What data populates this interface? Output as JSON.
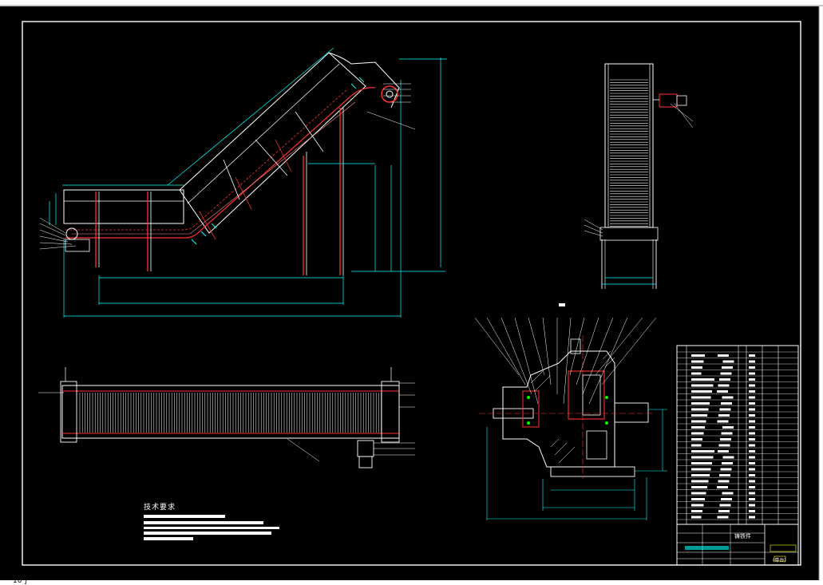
{
  "drawing": {
    "tech_requirements_heading": "技术要求",
    "title_block_label": "铸铁件",
    "title_block_sub": "(单台)",
    "corner_fragment": "10 ∫"
  },
  "colors": {
    "background": "#000000",
    "frame": "#ffffff",
    "dimension": "#00ffff",
    "red": "#ff2020",
    "green": "#00ff00",
    "window": "#ffffff"
  }
}
